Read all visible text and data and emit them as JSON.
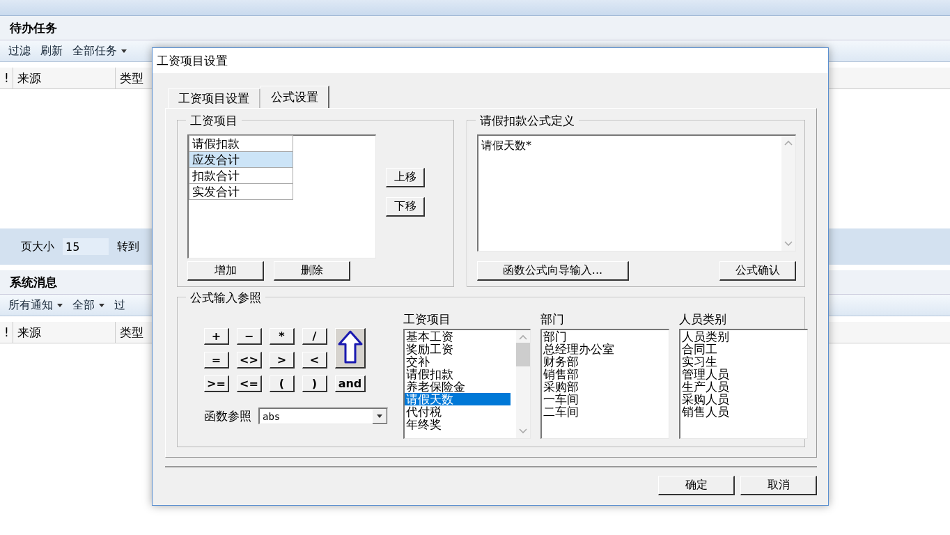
{
  "background": {
    "tasks": {
      "title": "待办任务",
      "toolbar": [
        {
          "label": "过滤",
          "dropdown": false
        },
        {
          "label": "刷新",
          "dropdown": false
        },
        {
          "label": "全部任务",
          "dropdown": true
        }
      ],
      "columns": [
        "!",
        "来源",
        "类型"
      ]
    },
    "pager": {
      "page_size_label": "页大小",
      "page_size": "15",
      "goto_label": "转到"
    },
    "messages": {
      "title": "系统消息",
      "toolbar": [
        {
          "label": "所有通知",
          "dropdown": true
        },
        {
          "label": "全部",
          "dropdown": true
        },
        {
          "label": "过",
          "dropdown": false
        }
      ],
      "columns": [
        "!",
        "来源",
        "类型"
      ]
    }
  },
  "dialog": {
    "title": "工资项目设置",
    "tabs": [
      {
        "label": "工资项目设置",
        "selected": false
      },
      {
        "label": "公式设置",
        "selected": true
      }
    ],
    "items_group": {
      "title": "工资项目",
      "items": [
        {
          "label": "请假扣款",
          "selected": false
        },
        {
          "label": "应发合计",
          "selected": true
        },
        {
          "label": "扣款合计",
          "selected": false
        },
        {
          "label": "实发合计",
          "selected": false
        }
      ],
      "move_buttons": [
        "上移",
        "下移"
      ],
      "buttons": [
        "增加",
        "删除"
      ]
    },
    "formula_group": {
      "title": "请假扣款公式定义",
      "value": "请假天数*",
      "buttons": [
        "函数公式向导输入...",
        "公式确认"
      ]
    },
    "reference_group": {
      "title": "公式输入参照",
      "operators": [
        "+",
        "−",
        "*",
        "/",
        "=",
        "<>",
        ">",
        "<",
        ">=",
        "<=",
        "(",
        ")"
      ],
      "logic_button": "and",
      "function_label": "函数参照",
      "function_value": "abs",
      "lists": [
        {
          "title": "工资项目",
          "scrollable": true,
          "items": [
            {
              "label": "基本工资",
              "selected": false
            },
            {
              "label": "奖励工资",
              "selected": false
            },
            {
              "label": "交补",
              "selected": false
            },
            {
              "label": "请假扣款",
              "selected": false
            },
            {
              "label": "养老保险金",
              "selected": false
            },
            {
              "label": "请假天数",
              "selected": true
            },
            {
              "label": "代付税",
              "selected": false
            },
            {
              "label": "年终奖",
              "selected": false
            }
          ]
        },
        {
          "title": "部门",
          "scrollable": false,
          "items": [
            {
              "label": "部门",
              "selected": false
            },
            {
              "label": "总经理办公室",
              "selected": false
            },
            {
              "label": "财务部",
              "selected": false
            },
            {
              "label": "销售部",
              "selected": false
            },
            {
              "label": "采购部",
              "selected": false
            },
            {
              "label": "一车间",
              "selected": false
            },
            {
              "label": "二车间",
              "selected": false
            }
          ]
        },
        {
          "title": "人员类别",
          "scrollable": false,
          "items": [
            {
              "label": "人员类别",
              "selected": false
            },
            {
              "label": "合同工",
              "selected": false
            },
            {
              "label": "实习生",
              "selected": false
            },
            {
              "label": "管理人员",
              "selected": false
            },
            {
              "label": "生产人员",
              "selected": false
            },
            {
              "label": "采购人员",
              "selected": false
            },
            {
              "label": "销售人员",
              "selected": false
            }
          ]
        }
      ]
    },
    "footer_buttons": [
      "确定",
      "取消"
    ]
  }
}
